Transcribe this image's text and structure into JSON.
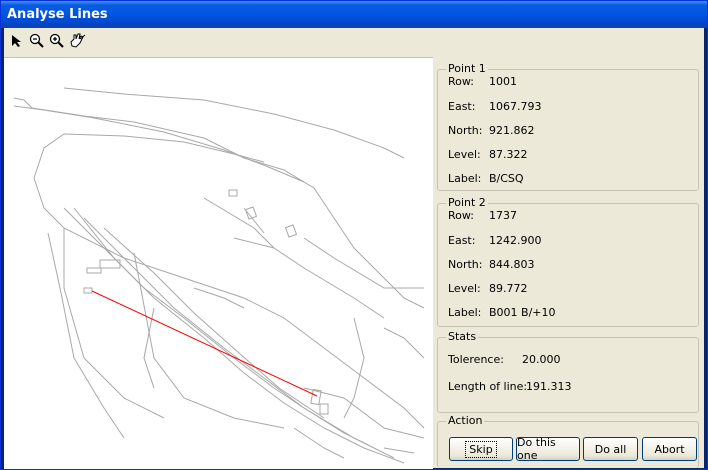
{
  "window": {
    "title": "Analyse Lines"
  },
  "toolbar": {
    "tools": [
      {
        "name": "select-arrow-icon"
      },
      {
        "name": "zoom-out-icon"
      },
      {
        "name": "zoom-in-icon"
      },
      {
        "name": "pan-hand-icon"
      }
    ]
  },
  "point1": {
    "legend": "Point 1",
    "row_label": "Row:",
    "row": "1001",
    "east_label": "East:",
    "east": "1067.793",
    "north_label": "North:",
    "north": "921.862",
    "level_label": "Level:",
    "level": "87.322",
    "label_label": "Label:",
    "label": "B/CSQ"
  },
  "point2": {
    "legend": "Point 2",
    "row_label": "Row:",
    "row": "1737",
    "east_label": "East:",
    "east": "1242.900",
    "north_label": "North:",
    "north": "844.803",
    "level_label": "Level:",
    "level": "89.772",
    "label_label": "Label:",
    "label": "B001 B/+10"
  },
  "stats": {
    "legend": "Stats",
    "tolerence_label": "Tolerence:",
    "tolerence": "20.000",
    "length_label": "Length of line:",
    "length": "191.313"
  },
  "action": {
    "legend": "Action",
    "skip": "Skip",
    "do_this_one": "Do this one",
    "do_all": "Do all",
    "abort": "Abort"
  },
  "colors": {
    "selected_line": "#ff0000",
    "map_lines": "#a0a0a0"
  }
}
